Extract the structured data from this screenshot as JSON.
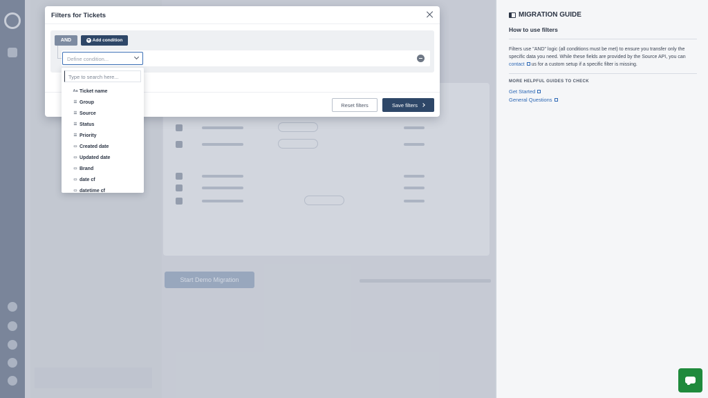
{
  "modal": {
    "title": "Filters for Tickets",
    "and_label": "AND",
    "add_condition_label": "Add condition",
    "condition_placeholder": "Define condition...",
    "reset_label": "Reset filters",
    "save_label": "Save filters"
  },
  "dropdown": {
    "search_placeholder": "Type to search here...",
    "items": [
      {
        "label": "Ticket name",
        "icon": "text-type-icon"
      },
      {
        "label": "Group",
        "icon": "list-icon"
      },
      {
        "label": "Source",
        "icon": "list-icon"
      },
      {
        "label": "Status",
        "icon": "list-icon"
      },
      {
        "label": "Priority",
        "icon": "list-icon"
      },
      {
        "label": "Created date",
        "icon": "calendar-icon"
      },
      {
        "label": "Updated date",
        "icon": "calendar-icon"
      },
      {
        "label": "Brand",
        "icon": "calendar-icon"
      },
      {
        "label": "date cf",
        "icon": "calendar-icon"
      },
      {
        "label": "datetime cf",
        "icon": "calendar-icon"
      }
    ]
  },
  "guide": {
    "title": "MIGRATION GUIDE",
    "subtitle": "How to use filters",
    "para_1": "Filters use \"AND\" logic (all conditions must be met) to ensure you transfer only the specific data you need. While these fields are provided by the Source API, you can",
    "contact_link": "contact",
    "para_2": "us for a custom setup if a specific filter is missing.",
    "more_heading": "MORE HELPFUL GUIDES TO CHECK",
    "links": [
      "Get Started",
      "General Questions"
    ]
  },
  "background": {
    "start_button": "Start Demo Migration"
  },
  "colors": {
    "primary": "#2e4768",
    "link": "#2d68b5",
    "chat": "#1f8a3c"
  }
}
